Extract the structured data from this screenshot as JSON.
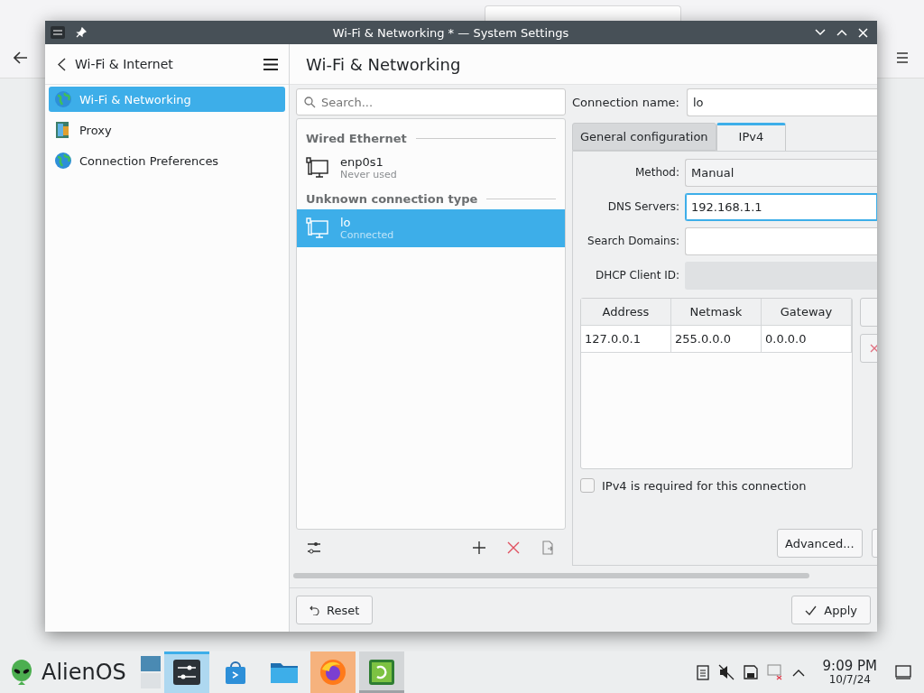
{
  "window": {
    "title": "Wi-Fi & Networking * — System Settings"
  },
  "sidebar": {
    "back_label": "Wi-Fi & Internet",
    "items": [
      {
        "label": "Wi-Fi & Networking",
        "selected": true,
        "kind": "globe"
      },
      {
        "label": "Proxy",
        "selected": false,
        "kind": "proxy"
      },
      {
        "label": "Connection Preferences",
        "selected": false,
        "kind": "globe"
      }
    ]
  },
  "page_title": "Wi-Fi & Networking",
  "connections": {
    "search_placeholder": "Search...",
    "groups": [
      {
        "title": "Wired Ethernet",
        "items": [
          {
            "name": "enp0s1",
            "status": "Never used",
            "selected": false
          }
        ]
      },
      {
        "title": "Unknown connection type",
        "items": [
          {
            "name": "lo",
            "status": "Connected",
            "selected": true
          }
        ]
      }
    ]
  },
  "editor": {
    "connection_name_label": "Connection name:",
    "connection_name": "lo",
    "tabs": [
      {
        "label": "General configuration",
        "selected": false
      },
      {
        "label": "IPv4",
        "selected": true
      }
    ],
    "fields": [
      {
        "label": "Method:",
        "kind": "dropdown",
        "value": "Manual"
      },
      {
        "label": "DNS Servers:",
        "kind": "input",
        "value": "192.168.1.1",
        "focused": true,
        "disabled": false
      },
      {
        "label": "Search Domains:",
        "kind": "input",
        "focused": false,
        "disabled": false
      },
      {
        "label": "DHCP Client ID:",
        "kind": "input",
        "focused": false,
        "disabled": true
      }
    ],
    "table": {
      "columns": [
        "Address",
        "Netmask",
        "Gateway"
      ],
      "rows": [
        [
          "127.0.0.1",
          "255.0.0.0",
          "0.0.0.0"
        ]
      ]
    },
    "required_checkbox": {
      "label": "IPv4 is required for this connection",
      "checked": false
    },
    "advanced_button": "Advanced..."
  },
  "footer": {
    "reset": "Reset",
    "apply": "Apply"
  },
  "taskbar": {
    "start_label": "AlienOS",
    "apps": [
      {
        "kind": "settings",
        "active": true,
        "attention": false,
        "hovered": false
      },
      {
        "kind": "store",
        "active": false,
        "attention": false,
        "hovered": false
      },
      {
        "kind": "files",
        "active": false,
        "attention": false,
        "hovered": false
      },
      {
        "kind": "firefox",
        "active": false,
        "attention": true,
        "hovered": false
      },
      {
        "kind": "terminal",
        "active": false,
        "attention": false,
        "hovered": true
      }
    ],
    "time": "9:09 PM",
    "date": "10/7/24"
  }
}
